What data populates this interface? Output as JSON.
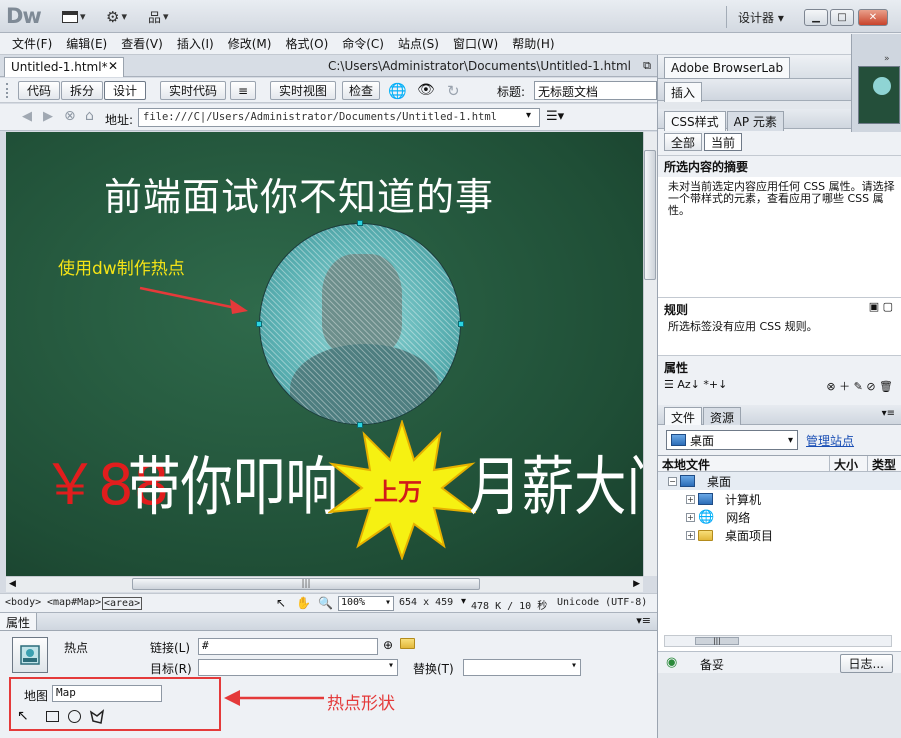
{
  "app": {
    "logo": "Dw",
    "workspace": "设计器",
    "window_buttons": [
      "▁",
      "□",
      "✕"
    ]
  },
  "menu": [
    "文件(F)",
    "编辑(E)",
    "查看(V)",
    "插入(I)",
    "修改(M)",
    "格式(O)",
    "命令(C)",
    "站点(S)",
    "窗口(W)",
    "帮助(H)"
  ],
  "document": {
    "tab": "Untitled-1.html*",
    "path": "C:\\Users\\Administrator\\Documents\\Untitled-1.html"
  },
  "view_bar": {
    "code": "代码",
    "split": "拆分",
    "design": "设计",
    "live_code": "实时代码",
    "live_view": "实时视图",
    "inspect": "检查",
    "title_label": "标题:",
    "title_value": "无标题文档"
  },
  "address": {
    "label": "地址:",
    "value": "file:///C|/Users/Administrator/Documents/Untitled-1.html"
  },
  "canvas": {
    "headline": "前端面试你不知道的事",
    "annotation": "使用dw制作热点",
    "price": "￥88",
    "text_left": "带你叩响",
    "burst": "上万",
    "text_right": "月薪大门"
  },
  "status": {
    "tags": [
      "<body>",
      "<map#Map>",
      "<area>"
    ],
    "zoom": "100%",
    "size": "654 x 459",
    "download": "478 K / 10 秒",
    "encoding": "Unicode (UTF-8)"
  },
  "properties": {
    "header": "属性",
    "hotspot_label": "热点",
    "link_label": "链接(L)",
    "link_value": "#",
    "target_label": "目标(R)",
    "alt_label": "替换(T)",
    "map_label": "地图",
    "map_value": "Map",
    "annotation": "热点形状"
  },
  "right_panel": {
    "browserlab": "Adobe BrowserLab",
    "insert": "插入",
    "tab_css": "CSS样式",
    "tab_ap": "AP 元素",
    "btn_all": "全部",
    "btn_current": "当前",
    "summary_title": "所选内容的摘要",
    "summary_text": "未对当前选定内容应用任何 CSS 属性。请选择一个带样式的元素，查看应用了哪些 CSS 属性。",
    "rules_title": "规则",
    "rules_text": "所选标签没有应用 CSS 规则。",
    "props_title": "属性",
    "files_tab": "文件",
    "assets_tab": "资源",
    "site_select": "桌面",
    "manage_sites": "管理站点",
    "col_local": "本地文件",
    "col_size": "大小",
    "col_type": "类型",
    "tree": [
      {
        "label": "桌面",
        "level": 0
      },
      {
        "label": "计算机",
        "level": 1
      },
      {
        "label": "网络",
        "level": 1
      },
      {
        "label": "桌面项目",
        "level": 1
      }
    ],
    "ready": "备妥",
    "log": "日志..."
  }
}
